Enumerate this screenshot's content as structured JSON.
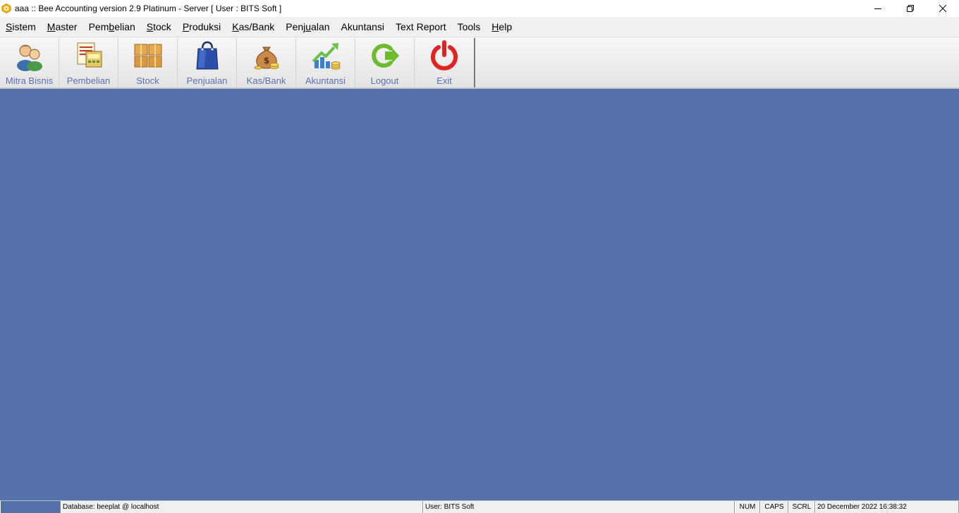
{
  "window": {
    "title": "aaa :: Bee Accounting version 2.9 Platinum - Server  [ User : BITS Soft ]",
    "controls": [
      "minimize-icon",
      "restore-icon",
      "close-icon"
    ]
  },
  "menu": {
    "items": [
      {
        "pre": "",
        "ul": "S",
        "post": "istem"
      },
      {
        "pre": "",
        "ul": "M",
        "post": "aster"
      },
      {
        "pre": "Pem",
        "ul": "b",
        "post": "elian"
      },
      {
        "pre": "",
        "ul": "S",
        "post": "tock"
      },
      {
        "pre": "",
        "ul": "P",
        "post": "roduksi"
      },
      {
        "pre": "",
        "ul": "K",
        "post": "as/Bank"
      },
      {
        "pre": "Penj",
        "ul": "u",
        "post": "alan"
      },
      {
        "pre": "Akuntansi",
        "ul": "",
        "post": ""
      },
      {
        "pre": "Text Report",
        "ul": "",
        "post": ""
      },
      {
        "pre": "Tools",
        "ul": "",
        "post": ""
      },
      {
        "pre": "",
        "ul": "H",
        "post": "elp"
      }
    ]
  },
  "toolbar": {
    "buttons": [
      {
        "label": "Mitra Bisnis",
        "icon": "users-icon"
      },
      {
        "label": "Pembelian",
        "icon": "purchase-icon"
      },
      {
        "label": "Stock",
        "icon": "boxes-icon"
      },
      {
        "label": "Penjualan",
        "icon": "shopping-bag-icon"
      },
      {
        "label": "Kas/Bank",
        "icon": "money-bag-icon"
      },
      {
        "label": "Akuntansi",
        "icon": "chart-up-icon"
      },
      {
        "label": "Logout",
        "icon": "logout-icon"
      },
      {
        "label": "Exit",
        "icon": "power-icon"
      }
    ]
  },
  "statusbar": {
    "database": "Database: beeplat @ localhost",
    "user": "User: BITS Soft",
    "num": "NUM",
    "caps": "CAPS",
    "scrl": "SCRL",
    "datetime": "20 December 2022  16:38:32"
  },
  "colors": {
    "workspace": "#5571aa",
    "toolbar_label": "#5a6fb0"
  }
}
